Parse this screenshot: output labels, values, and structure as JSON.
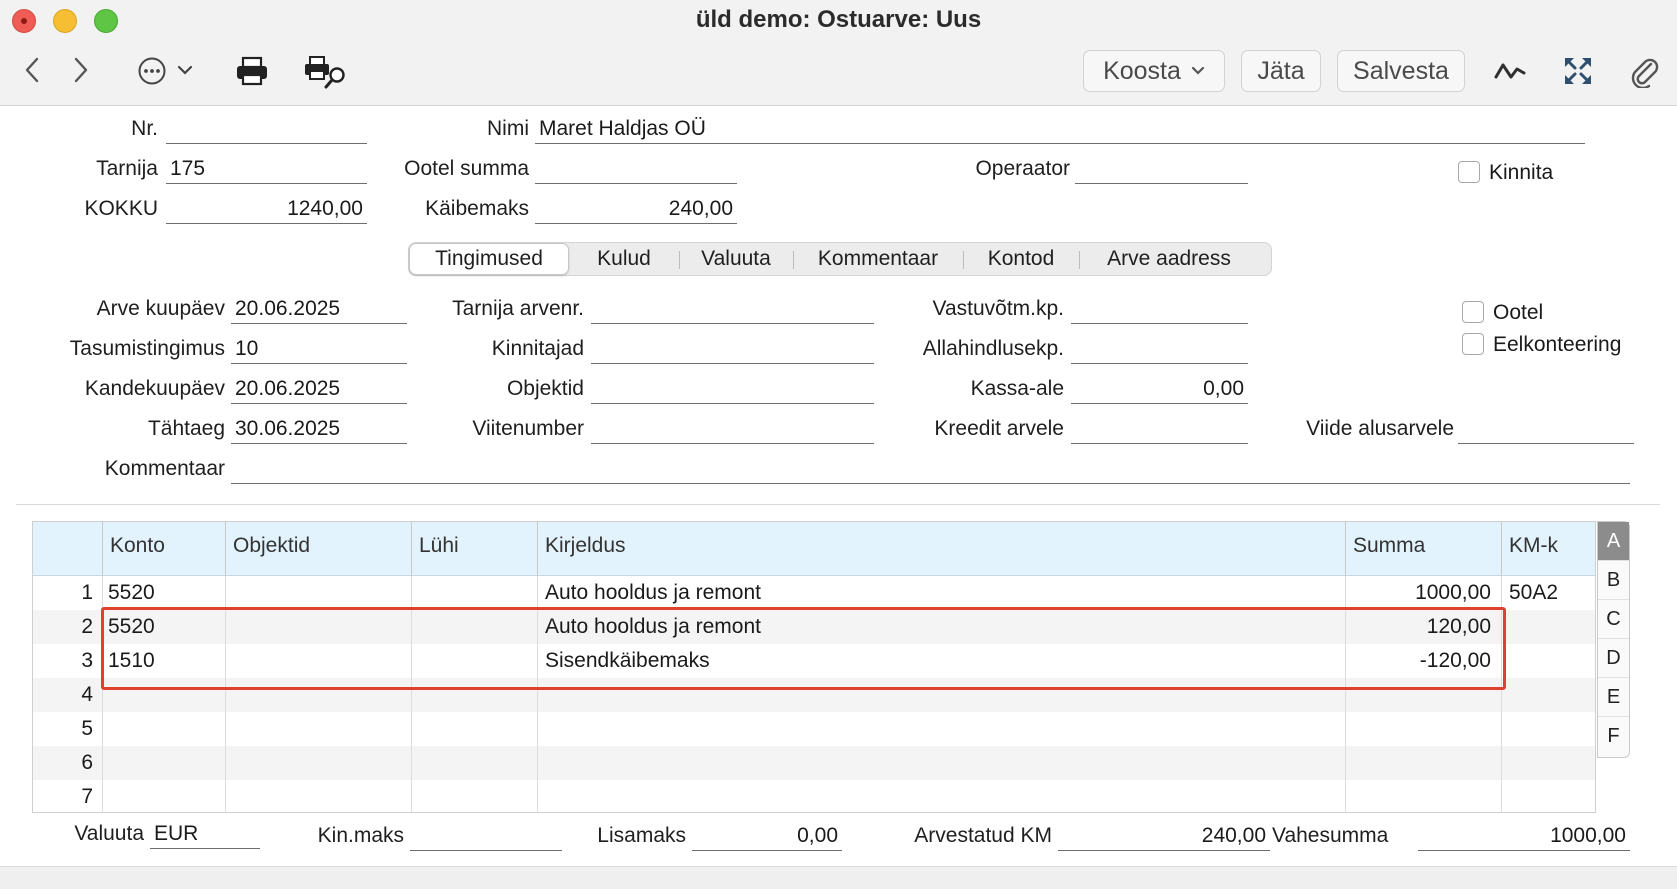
{
  "window": {
    "title": "üld demo: Ostuarve: Uus"
  },
  "toolbar": {
    "koosta_label": "Koosta",
    "jata_label": "Jäta",
    "salvesta_label": "Salvesta"
  },
  "header": {
    "nr": {
      "label": "Nr.",
      "value": ""
    },
    "nimi": {
      "label": "Nimi",
      "value": "Maret Haldjas OÜ"
    },
    "tarnija": {
      "label": "Tarnija",
      "value": "175"
    },
    "ootel_summa": {
      "label": "Ootel summa",
      "value": ""
    },
    "operaator": {
      "label": "Operaator",
      "value": ""
    },
    "kinnita": {
      "label": "Kinnita",
      "checked": false
    },
    "kokku": {
      "label": "KOKKU",
      "value": "1240,00"
    },
    "kaibemaks": {
      "label": "Käibemaks",
      "value": "240,00"
    }
  },
  "tabs": [
    {
      "label": "Tingimused",
      "active": true
    },
    {
      "label": "Kulud",
      "active": false
    },
    {
      "label": "Valuuta",
      "active": false
    },
    {
      "label": "Kommentaar",
      "active": false
    },
    {
      "label": "Kontod",
      "active": false
    },
    {
      "label": "Arve aadress",
      "active": false
    }
  ],
  "terms": {
    "arve_kuupaev": {
      "label": "Arve kuupäev",
      "value": "20.06.2025"
    },
    "tasumistingimus": {
      "label": "Tasumistingimus",
      "value": "10"
    },
    "kandekuupaev": {
      "label": "Kandekuupäev",
      "value": "20.06.2025"
    },
    "tahtaeg": {
      "label": "Tähtaeg",
      "value": "30.06.2025"
    },
    "kommentaar": {
      "label": "Kommentaar",
      "value": ""
    },
    "tarnija_arvenr": {
      "label": "Tarnija arvenr.",
      "value": ""
    },
    "kinnitajad": {
      "label": "Kinnitajad",
      "value": ""
    },
    "objektid": {
      "label": "Objektid",
      "value": ""
    },
    "viitenumber": {
      "label": "Viitenumber",
      "value": ""
    },
    "vastuvotm_kp": {
      "label": "Vastuvõtm.kp.",
      "value": ""
    },
    "allahindlusekp": {
      "label": "Allahindlusekp.",
      "value": ""
    },
    "kassa_ale": {
      "label": "Kassa-ale",
      "value": "0,00"
    },
    "kreedit_arvele": {
      "label": "Kreedit arvele",
      "value": ""
    },
    "viide_alusarvele": {
      "label": "Viide alusarvele",
      "value": ""
    },
    "ootel": {
      "label": "Ootel",
      "checked": false
    },
    "eelkonteering": {
      "label": "Eelkonteering",
      "checked": false
    }
  },
  "grid": {
    "columns": [
      "Konto",
      "Objektid",
      "Lühi",
      "Kirjeldus",
      "Summa",
      "KM-k"
    ],
    "rows": [
      {
        "n": "1",
        "konto": "5520",
        "objektid": "",
        "luhi": "",
        "kirjeldus": "Auto hooldus ja remont",
        "summa": "1000,00",
        "kmk": "50A2"
      },
      {
        "n": "2",
        "konto": "5520",
        "objektid": "",
        "luhi": "",
        "kirjeldus": "Auto hooldus ja remont",
        "summa": "120,00",
        "kmk": ""
      },
      {
        "n": "3",
        "konto": "1510",
        "objektid": "",
        "luhi": "",
        "kirjeldus": "Sisendkäibemaks",
        "summa": "-120,00",
        "kmk": ""
      },
      {
        "n": "4",
        "konto": "",
        "objektid": "",
        "luhi": "",
        "kirjeldus": "",
        "summa": "",
        "kmk": ""
      },
      {
        "n": "5",
        "konto": "",
        "objektid": "",
        "luhi": "",
        "kirjeldus": "",
        "summa": "",
        "kmk": ""
      },
      {
        "n": "6",
        "konto": "",
        "objektid": "",
        "luhi": "",
        "kirjeldus": "",
        "summa": "",
        "kmk": ""
      },
      {
        "n": "7",
        "konto": "",
        "objektid": "",
        "luhi": "",
        "kirjeldus": "",
        "summa": "",
        "kmk": ""
      }
    ],
    "side_tabs": [
      "A",
      "B",
      "C",
      "D",
      "E",
      "F"
    ],
    "active_side_tab": "A",
    "highlight_color": "#e0412e"
  },
  "footer": {
    "valuuta": {
      "label": "Valuuta",
      "value": "EUR"
    },
    "kin_maks": {
      "label": "Kin.maks",
      "value": ""
    },
    "lisamaks": {
      "label": "Lisamaks",
      "value": "0,00"
    },
    "arvestatud_km": {
      "label": "Arvestatud KM",
      "value": "240,00"
    },
    "vahesumma": {
      "label": "Vahesumma",
      "value": "1000,00"
    }
  }
}
